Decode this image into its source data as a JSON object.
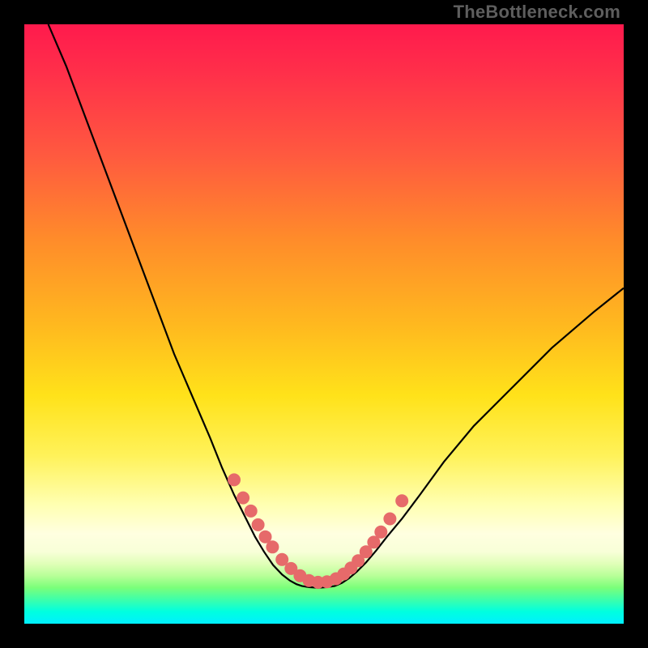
{
  "watermark": "TheBottleneck.com",
  "chart_data": {
    "type": "line",
    "title": "",
    "xlabel": "",
    "ylabel": "",
    "xlim": [
      0,
      100
    ],
    "ylim": [
      0,
      100
    ],
    "curves": [
      {
        "name": "left",
        "x": [
          4,
          7,
          10,
          13,
          16,
          19,
          22,
          25,
          28,
          31,
          33,
          35,
          37,
          38.5,
          40,
          41.5,
          43,
          44.3,
          45.4,
          46.3
        ],
        "y": [
          100,
          93,
          85,
          77,
          69,
          61,
          53,
          45,
          38,
          31,
          26,
          21.5,
          17.5,
          14.5,
          12,
          9.8,
          8.2,
          7.2,
          6.6,
          6.3
        ]
      },
      {
        "name": "floor",
        "x": [
          46.3,
          47.5,
          49,
          50.5,
          51.8
        ],
        "y": [
          6.3,
          6.1,
          6.0,
          6.1,
          6.3
        ]
      },
      {
        "name": "right",
        "x": [
          51.8,
          53,
          54.2,
          55.5,
          57,
          58.7,
          60.5,
          63,
          66,
          70,
          75,
          81,
          88,
          95,
          100
        ],
        "y": [
          6.3,
          6.8,
          7.6,
          8.7,
          10.2,
          12.2,
          14.5,
          17.5,
          21.5,
          27,
          33,
          39,
          46,
          52,
          56
        ]
      }
    ],
    "points": {
      "name": "data-points",
      "x": [
        35,
        36.5,
        37.8,
        39,
        40.2,
        41.4,
        43,
        44.5,
        46,
        47.5,
        49,
        50.5,
        52,
        53.3,
        54.5,
        55.7,
        57,
        58.3,
        59.5,
        61,
        63
      ],
      "y": [
        24,
        21,
        18.8,
        16.5,
        14.5,
        12.8,
        10.7,
        9.2,
        8,
        7.2,
        6.9,
        7.0,
        7.5,
        8.3,
        9.3,
        10.5,
        12,
        13.6,
        15.3,
        17.5,
        20.5
      ]
    },
    "gradient_stops": [
      {
        "pos": 0.0,
        "color": "#ff1a4d"
      },
      {
        "pos": 0.22,
        "color": "#ff5a3f"
      },
      {
        "pos": 0.5,
        "color": "#ffb81f"
      },
      {
        "pos": 0.72,
        "color": "#fff25a"
      },
      {
        "pos": 0.85,
        "color": "#ffffe0"
      },
      {
        "pos": 0.94,
        "color": "#7aff7a"
      },
      {
        "pos": 1.0,
        "color": "#00f0ff"
      }
    ]
  }
}
